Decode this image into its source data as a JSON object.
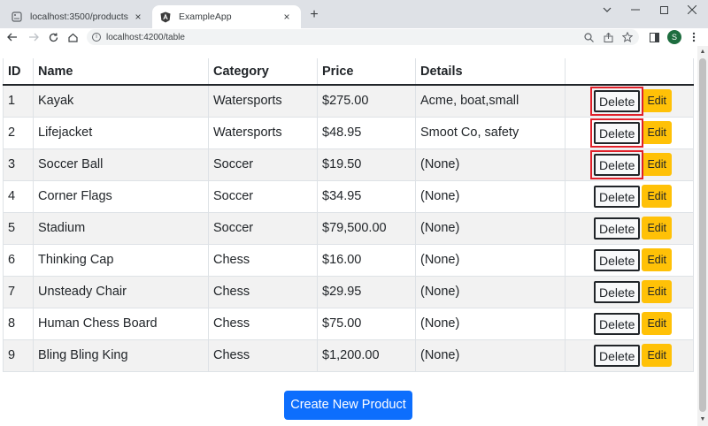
{
  "browser": {
    "tabs": [
      {
        "title": "localhost:3500/products",
        "close_icon": "×"
      },
      {
        "title": "ExampleApp",
        "close_icon": "×"
      }
    ],
    "new_tab": "+",
    "url": "localhost:4200/table",
    "profile_initial": "S"
  },
  "table": {
    "headers": {
      "id": "ID",
      "name": "Name",
      "category": "Category",
      "price": "Price",
      "details": "Details"
    },
    "rows": [
      {
        "id": "1",
        "name": "Kayak",
        "category": "Watersports",
        "price": "$275.00",
        "details": "Acme, boat,small"
      },
      {
        "id": "2",
        "name": "Lifejacket",
        "category": "Watersports",
        "price": "$48.95",
        "details": "Smoot Co, safety"
      },
      {
        "id": "3",
        "name": "Soccer Ball",
        "category": "Soccer",
        "price": "$19.50",
        "details": "(None)"
      },
      {
        "id": "4",
        "name": "Corner Flags",
        "category": "Soccer",
        "price": "$34.95",
        "details": "(None)"
      },
      {
        "id": "5",
        "name": "Stadium",
        "category": "Soccer",
        "price": "$79,500.00",
        "details": "(None)"
      },
      {
        "id": "6",
        "name": "Thinking Cap",
        "category": "Chess",
        "price": "$16.00",
        "details": "(None)"
      },
      {
        "id": "7",
        "name": "Unsteady Chair",
        "category": "Chess",
        "price": "$29.95",
        "details": "(None)"
      },
      {
        "id": "8",
        "name": "Human Chess Board",
        "category": "Chess",
        "price": "$75.00",
        "details": "(None)"
      },
      {
        "id": "9",
        "name": "Bling Bling King",
        "category": "Chess",
        "price": "$1,200.00",
        "details": "(None)"
      }
    ],
    "delete_label": "Delete",
    "edit_label": "Edit"
  },
  "create_button": "Create New Product",
  "colors": {
    "highlight": "#e0202a",
    "edit": "#ffc107",
    "primary": "#0d6efd"
  }
}
